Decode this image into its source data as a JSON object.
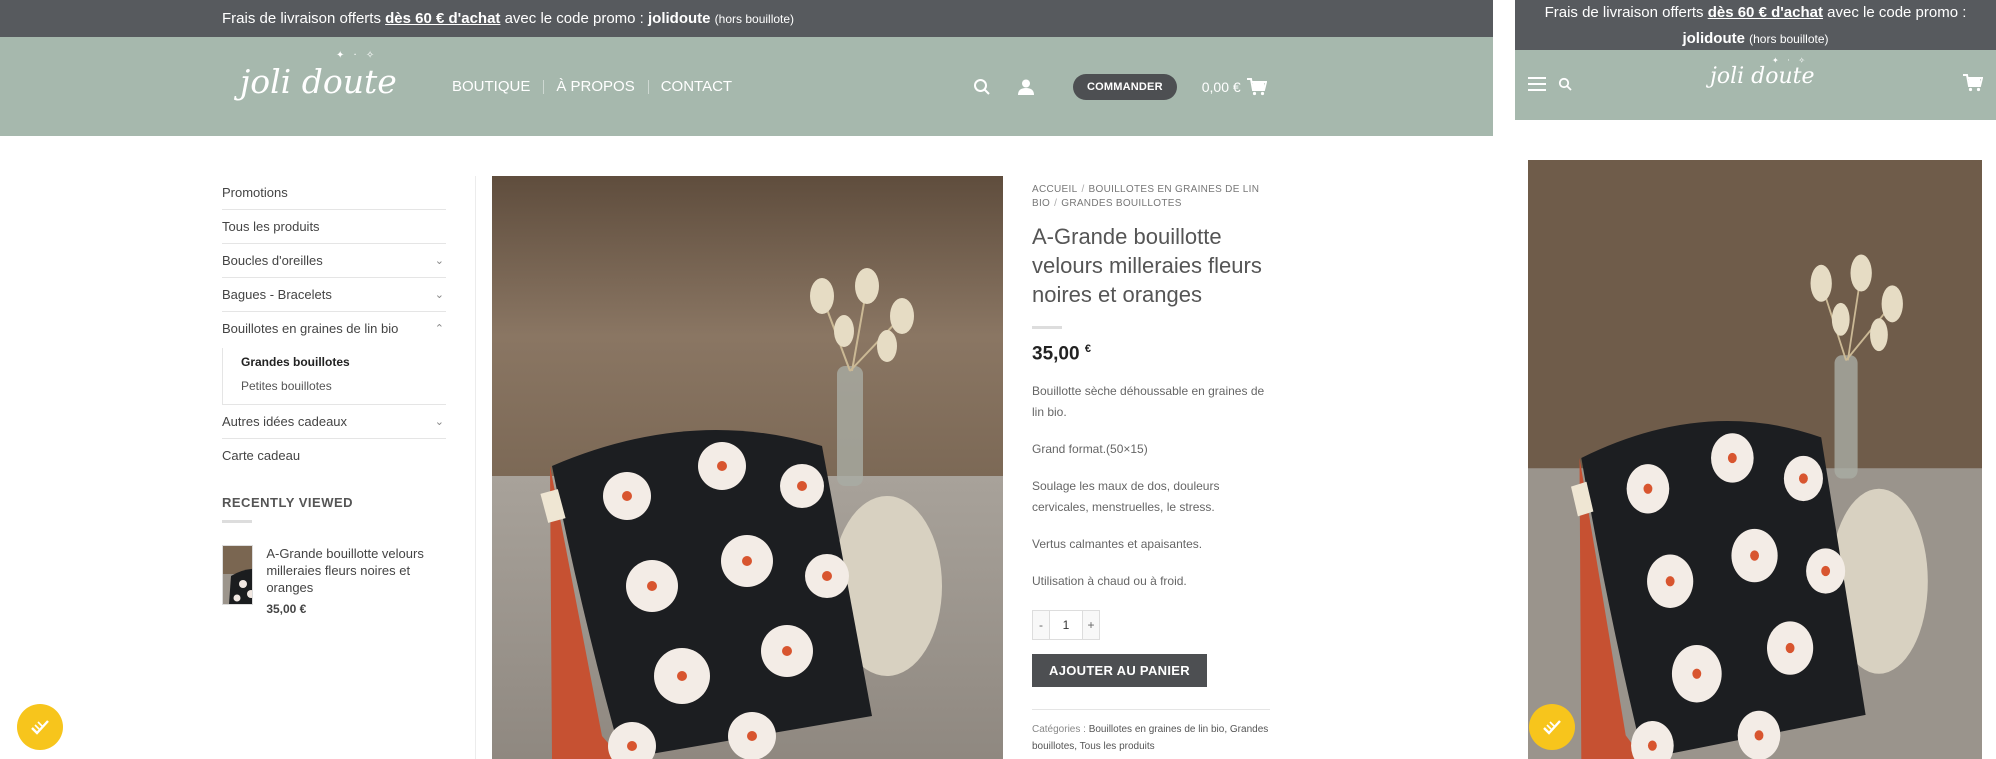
{
  "promo": {
    "prefix": "Frais de livraison offerts ",
    "threshold": "dès 60 € d'achat",
    "middle": " avec le code promo : ",
    "code": "jolidoute",
    "suffix": "(hors bouillote)"
  },
  "logo": {
    "text": "joli doute"
  },
  "nav": {
    "items": [
      "BOUTIQUE",
      "À PROPOS",
      "CONTACT"
    ]
  },
  "header": {
    "order_label": "COMMANDER",
    "cart_total": "0,00 €"
  },
  "sidebar": {
    "categories": [
      {
        "label": "Promotions"
      },
      {
        "label": "Tous les produits"
      },
      {
        "label": "Boucles d'oreilles",
        "chevron": "⌄"
      },
      {
        "label": "Bagues - Bracelets",
        "chevron": "⌄"
      },
      {
        "label": "Bouillotes en graines de lin bio",
        "chevron": "⌃"
      }
    ],
    "subcategories": [
      {
        "label": "Grandes bouillotes",
        "active": true
      },
      {
        "label": "Petites bouillotes"
      }
    ],
    "categories_after": [
      {
        "label": "Autres idées cadeaux",
        "chevron": "⌄"
      },
      {
        "label": "Carte cadeau"
      }
    ],
    "recently_viewed": {
      "title": "RECENTLY VIEWED",
      "item_name": "A-Grande bouillotte velours milleraies fleurs noires et oranges",
      "item_price": "35,00 €"
    }
  },
  "product": {
    "breadcrumb": [
      "ACCUEIL",
      "BOUILLOTES EN GRAINES DE LIN BIO",
      "GRANDES BOUILLOTES"
    ],
    "title": "A-Grande bouillotte velours milleraies fleurs noires et oranges",
    "price": "35,00",
    "currency": "€",
    "description": [
      "Bouillotte sèche déhoussable en graines de lin bio.",
      "Grand format.(50×15)",
      "Soulage les maux de dos, douleurs cervicales,  menstruelles, le stress.",
      "Vertus calmantes et apaisantes.",
      "Utilisation à chaud ou à froid."
    ],
    "quantity": "1",
    "qty_minus": "-",
    "qty_plus": "+",
    "add_to_cart": "AJOUTER AU PANIER",
    "categories_label": "Catégories :",
    "categories_value": " Bouillotes en graines de lin bio, Grandes bouillotes, Tous les produits"
  },
  "colors": {
    "promo_bg": "#575a5e",
    "header_bg": "#a6b8ad",
    "button_dark": "#4d4f52",
    "cookie_badge": "#f7c51c"
  },
  "icons": [
    "search-icon",
    "user-icon",
    "cart-icon",
    "chevron-down-icon",
    "chevron-up-icon",
    "hamburger-icon",
    "cookie-consent-icon"
  ]
}
